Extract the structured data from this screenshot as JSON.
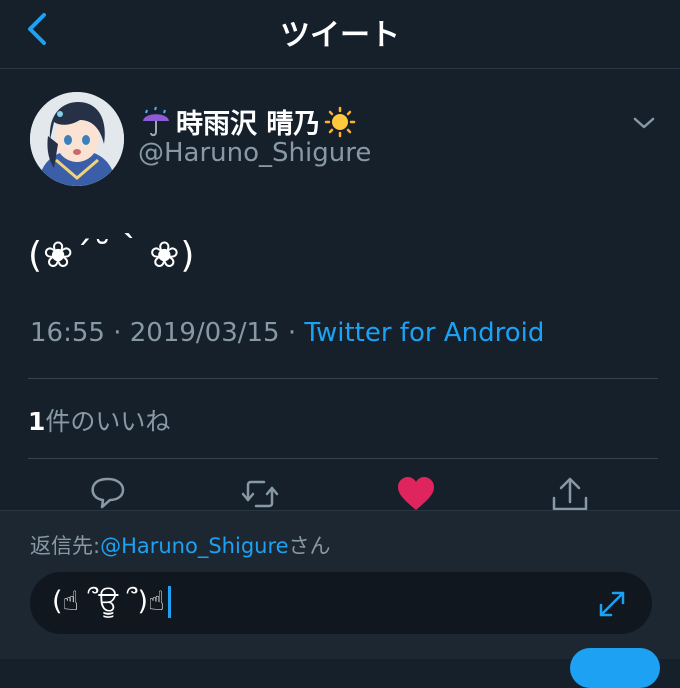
{
  "header": {
    "title": "ツイート"
  },
  "tweet": {
    "display_name": "時雨沢 晴乃",
    "handle": "@Haruno_Shigure",
    "text": "(❀´˘｀❀)",
    "time": "16:55",
    "date": "2019/03/15",
    "separator": "·",
    "source": "Twitter for Android",
    "likes_count": "1",
    "likes_label": "件のいいね",
    "liked": true
  },
  "reply": {
    "prefix": "返信先:",
    "mention": "@Haruno_Shigure",
    "suffix": "さん",
    "compose_text": "(☝ ՞ਊ ՞)☝"
  },
  "colors": {
    "background": "#15202b",
    "accent": "#1da1f2",
    "like": "#e0245e",
    "muted": "#8899a6"
  },
  "icons": [
    "back-chevron-icon",
    "umbrella-rain-icon",
    "sun-icon",
    "chevron-down-icon",
    "reply-icon",
    "retweet-icon",
    "heart-icon",
    "share-icon",
    "expand-icon"
  ]
}
